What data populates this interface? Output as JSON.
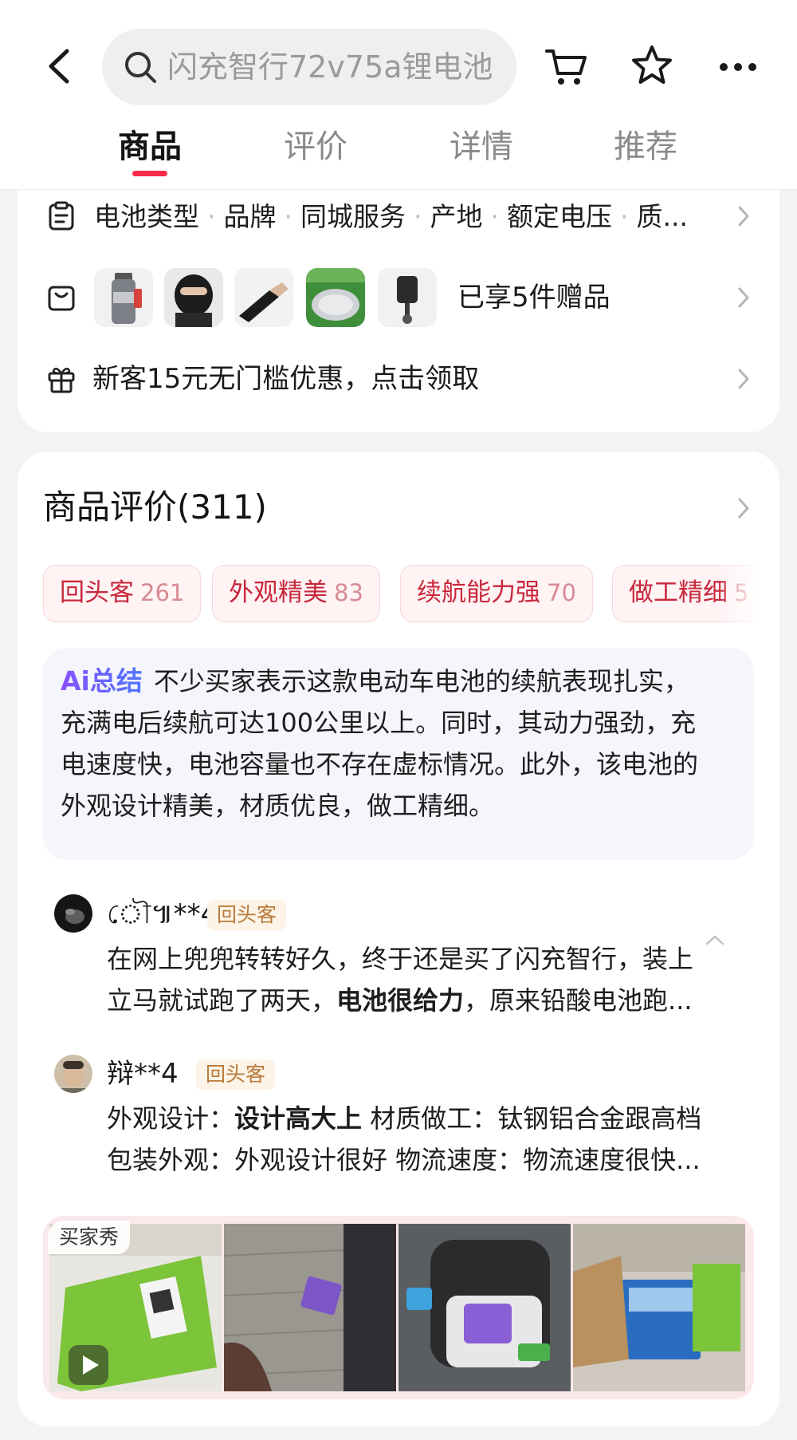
{
  "header": {
    "search_placeholder": "闪充智行72v75a锂电池",
    "icons": [
      "back-icon",
      "search-icon",
      "cart-icon",
      "star-icon",
      "more-icon"
    ]
  },
  "tabs": [
    {
      "label": "商品",
      "active": true
    },
    {
      "label": "评价",
      "active": false
    },
    {
      "label": "详情",
      "active": false
    },
    {
      "label": "推荐",
      "active": false
    }
  ],
  "attributes": {
    "items": [
      "电池类型",
      "品牌",
      "同城服务",
      "产地",
      "额定电压",
      "质..."
    ]
  },
  "gifts": {
    "label": "已享5件赠品",
    "items": [
      "water-bottle",
      "face-mask",
      "arm-sleeve",
      "seat-cushion",
      "phone-holder"
    ]
  },
  "coupon": {
    "label": "新客15元无门槛优惠，点击领取"
  },
  "reviews": {
    "title": "商品评价(311)",
    "chips": [
      {
        "label": "回头客",
        "count": "261"
      },
      {
        "label": "外观精美",
        "count": "83"
      },
      {
        "label": "续航能力强",
        "count": "70"
      },
      {
        "label": "做工精细",
        "count": "5"
      }
    ],
    "ai_summary": {
      "badge": "Ai总结",
      "text": "不少买家表示这款电动车电池的续航表现扎实，充满电后续航可达100公里以上。同时，其动力强劲，充电速度快，电池容量也不存在虚标情况。此外，该电池的外观设计精美，材质优良，做工精细。"
    },
    "items": [
      {
        "user": "ৌ៕**4",
        "tag": "回头客",
        "line1": "在网上兜兜转转好久，终于还是买了闪充智行，装上",
        "line2_pre": "立马就试跑了两天，",
        "line2_bold": "电池很给力",
        "line2_post": "，原来铅酸电池跑..."
      },
      {
        "user": "辩**4",
        "tag": "回头客",
        "line1_pre": "外观设计：",
        "line1_bold": "设计高大上",
        "line1_post": " 材质做工：钛钢铝合金跟高档",
        "line2": "包装外观：外观设计很好 物流速度：物流速度很快..."
      }
    ],
    "gallery": {
      "label": "买家秀",
      "photos": [
        "green-package",
        "purple-battery-ground",
        "battery-in-scooter",
        "boxed-battery"
      ]
    }
  }
}
